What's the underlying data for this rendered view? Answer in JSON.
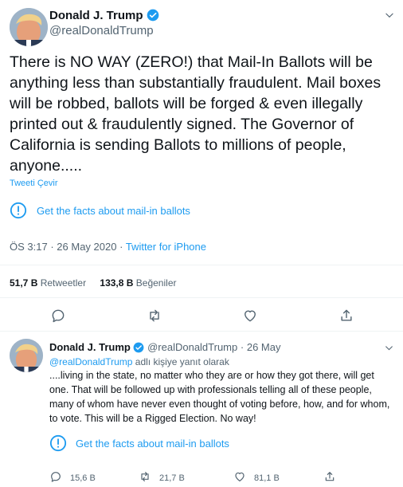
{
  "tweet": {
    "author_name": "Donald J. Trump",
    "handle": "@realDonaldTrump",
    "text": "There is NO WAY (ZERO!) that Mail-In Ballots will be anything less than substantially fraudulent. Mail boxes will be robbed, ballots will be forged & even illegally printed out & fraudulently signed. The Governor of California is sending Ballots to millions of people, anyone.....",
    "translate_label": "Tweeti Çevir",
    "fact_check_label": "Get the facts about mail-in ballots",
    "time": "ÖS 3:17",
    "date": "26 May 2020",
    "source": "Twitter for iPhone",
    "retweets_count": "51,7 B",
    "retweets_label": "Retweetler",
    "likes_count": "133,8 B",
    "likes_label": "Beğeniler",
    "separator": "·"
  },
  "reply": {
    "author_name": "Donald J. Trump",
    "handle": "@realDonaldTrump",
    "date": "26 May",
    "reply_to_handle": "@realDonaldTrump",
    "reply_to_suffix": " adlı kişiye yanıt olarak",
    "text": "....living in the state, no matter who they are or how they got there, will get one. That will be followed up with professionals telling all of these people, many of whom have never even thought of voting before, how, and for whom, to vote. This will be a Rigged Election. No way!",
    "fact_check_label": "Get the facts about mail-in ballots",
    "reply_count": "15,6 B",
    "retweet_count": "21,7 B",
    "like_count": "81,1 B",
    "separator": "·"
  },
  "icons": {
    "verified": "verified-badge-icon",
    "chevron": "chevron-down-icon",
    "info": "info-circle-icon",
    "reply": "reply-icon",
    "retweet": "retweet-icon",
    "like": "heart-icon",
    "share": "share-icon"
  },
  "colors": {
    "accent": "#1d9bf0",
    "text": "#0f1419",
    "secondary": "#536471",
    "divider": "#eff3f4"
  }
}
